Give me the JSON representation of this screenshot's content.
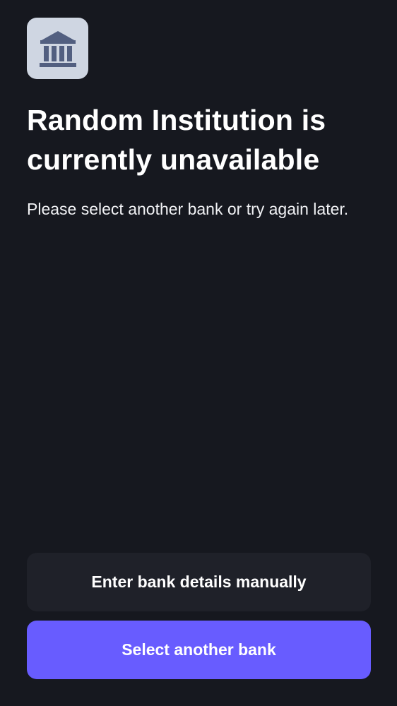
{
  "institution": {
    "logo_icon": "bank-building-icon",
    "logo_background": "#cfd6e2",
    "logo_icon_color": "#525f80"
  },
  "content": {
    "title": "Random Institution is currently unavailable",
    "message": "Please select another bank or try again later."
  },
  "actions": {
    "manual_label": "Enter bank details manually",
    "select_bank_label": "Select another bank"
  },
  "colors": {
    "background": "#16181f",
    "secondary_button": "#1f2129",
    "primary_button": "#685cff"
  }
}
